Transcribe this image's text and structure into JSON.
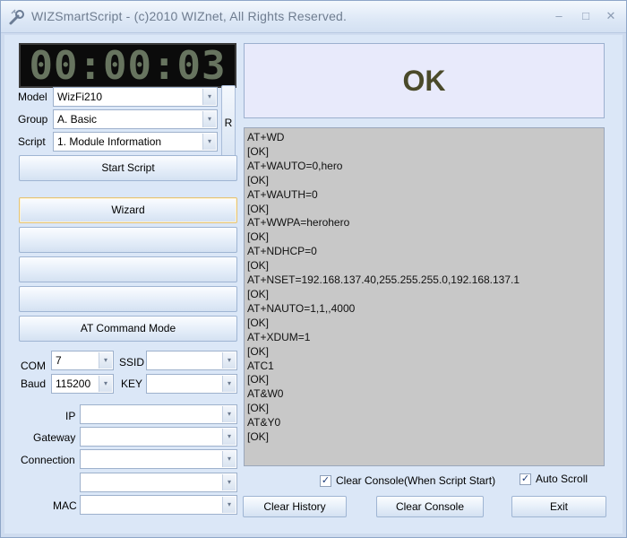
{
  "window": {
    "title": "WIZSmartScript - (c)2010 WIZnet, All Rights Reserved.",
    "minimize": "–",
    "maximize": "□",
    "close": "✕"
  },
  "timer": "00:00:03",
  "status": "OK",
  "left": {
    "model_label": "Model",
    "model_value": "WizFi210",
    "group_label": "Group",
    "group_value": "A. Basic",
    "script_label": "Script",
    "script_value": "1. Module Information",
    "refresh_label": "R",
    "start_script": "Start Script",
    "wizard": "Wizard",
    "blank_1": "",
    "blank_2": "",
    "blank_3": "",
    "at_mode": "AT Command Mode",
    "com_label": "COM",
    "com_value": "7",
    "baud_label": "Baud",
    "baud_value": "115200",
    "ssid_label": "SSID",
    "ssid_value": "",
    "key_label": "KEY",
    "key_value": "",
    "ip_label": "IP",
    "ip_value": "",
    "gateway_label": "Gateway",
    "gateway_value": "",
    "connection_label": "Connection",
    "connection_value": "",
    "extra_value": "",
    "mac_label": "MAC",
    "mac_value": ""
  },
  "console_lines": [
    "AT+WD",
    "[OK]",
    "AT+WAUTO=0,hero",
    "[OK]",
    "AT+WAUTH=0",
    "[OK]",
    "AT+WWPA=herohero",
    "[OK]",
    "AT+NDHCP=0",
    "[OK]",
    "AT+NSET=192.168.137.40,255.255.255.0,192.168.137.1",
    "[OK]",
    "AT+NAUTO=1,1,,4000",
    "[OK]",
    "AT+XDUM=1",
    "[OK]",
    "ATC1",
    "[OK]",
    "AT&W0",
    "[OK]",
    "AT&Y0",
    "[OK]"
  ],
  "options": {
    "clear_console_start": "Clear Console(When Script Start)",
    "clear_console_start_checked": true,
    "auto_scroll": "Auto Scroll",
    "auto_scroll_checked": true
  },
  "bottom": {
    "clear_history": "Clear History",
    "clear_console": "Clear Console",
    "exit": "Exit"
  },
  "icons": {
    "dropdown": "▾",
    "check": "✓"
  }
}
